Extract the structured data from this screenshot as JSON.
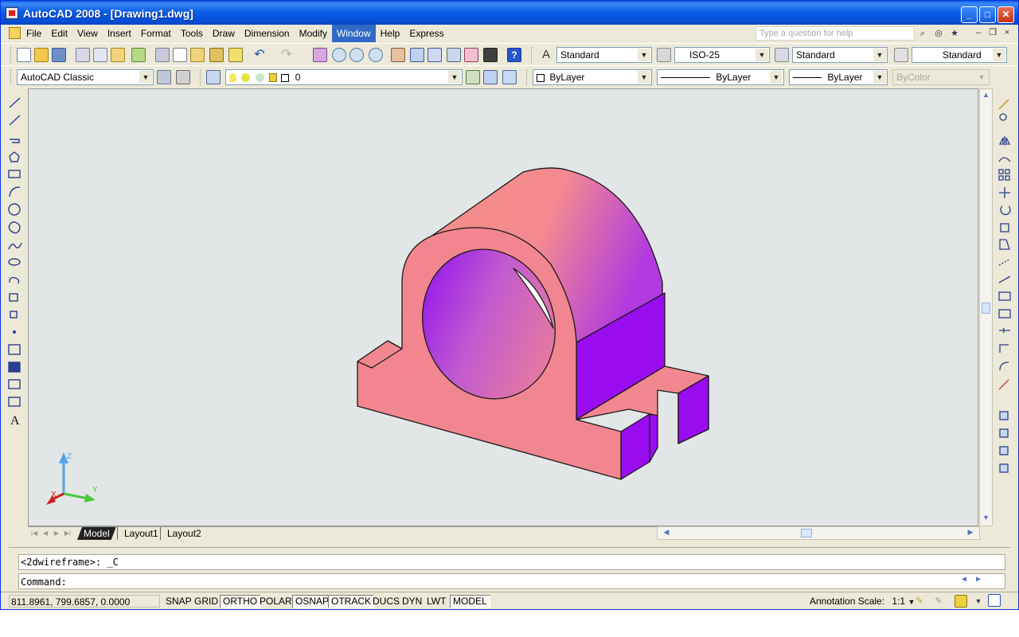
{
  "window": {
    "title": "AutoCAD 2008 - [Drawing1.dwg]",
    "controls": {
      "minimize": "_",
      "maximize": "□",
      "close": "✕"
    }
  },
  "menu": {
    "items": [
      "File",
      "Edit",
      "View",
      "Insert",
      "Format",
      "Tools",
      "Draw",
      "Dimension",
      "Modify",
      "Window",
      "Help",
      "Express"
    ],
    "active_index": 9,
    "help_placeholder": "Type a question for help",
    "mdi_controls": {
      "minimize": "–",
      "restore": "❐",
      "close": "×"
    }
  },
  "toolbar_styles": {
    "text_style": "Standard",
    "dim_style": "ISO-25",
    "table_style": "Standard",
    "multileader_style": "Standard"
  },
  "toolbar_workspace": {
    "workspace": "AutoCAD Classic",
    "layer": "0",
    "color": "ByLayer",
    "linetype": "ByLayer",
    "lineweight": "ByLayer",
    "plotstyle": "ByColor"
  },
  "ucs": {
    "x": "X",
    "y": "Y",
    "z": "Z"
  },
  "tabs": [
    "Model",
    "Layout1",
    "Layout2"
  ],
  "command": {
    "history": "<2dwireframe>: _C",
    "prompt": "Command:"
  },
  "status": {
    "coords": "811.8961, 799.6857, 0.0000",
    "buttons": [
      {
        "label": "SNAP",
        "on": false
      },
      {
        "label": "GRID",
        "on": false
      },
      {
        "label": "ORTHO",
        "on": true
      },
      {
        "label": "POLAR",
        "on": false
      },
      {
        "label": "OSNAP",
        "on": true
      },
      {
        "label": "OTRACK",
        "on": true
      },
      {
        "label": "DUCS",
        "on": false
      },
      {
        "label": "DYN",
        "on": false
      },
      {
        "label": "LWT",
        "on": false
      },
      {
        "label": "MODEL",
        "on": true
      }
    ],
    "annotation_scale_label": "Annotation Scale:",
    "annotation_scale_value": "1:1"
  },
  "colors": {
    "face_pink": "#f2878f",
    "face_purple": "#9a0cf0",
    "viewport_bg": "#e3e6e6"
  }
}
